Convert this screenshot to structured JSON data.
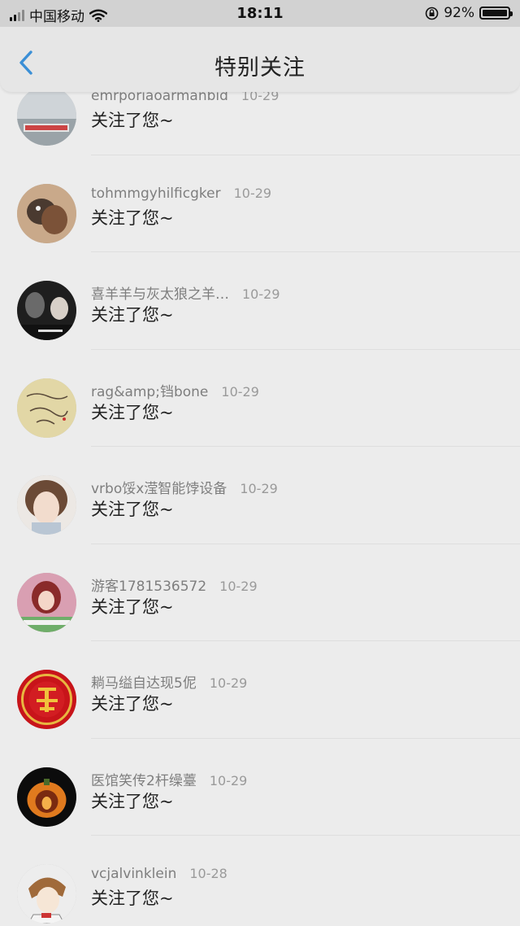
{
  "status_bar": {
    "carrier": "中国移动",
    "time": "18:11",
    "battery": "92%"
  },
  "nav": {
    "title": "特别关注"
  },
  "items": [
    {
      "name": "emrporiaoarmanbid",
      "date": "10-29",
      "message": "关注了您~"
    },
    {
      "name": "tohmmgyhilficgker",
      "date": "10-29",
      "message": "关注了您~"
    },
    {
      "name": "喜羊羊与灰太狼之羊…",
      "date": "10-29",
      "message": "关注了您~"
    },
    {
      "name": "rag&amp;铛bone",
      "date": "10-29",
      "message": "关注了您~"
    },
    {
      "name": "vrbo馁x滢智能饽设备",
      "date": "10-29",
      "message": "关注了您~"
    },
    {
      "name": "游客1781536572",
      "date": "10-29",
      "message": "关注了您~"
    },
    {
      "name": "耥马缢自达现5伲",
      "date": "10-29",
      "message": "关注了您~"
    },
    {
      "name": "医馆笑传2杆缲薹",
      "date": "10-29",
      "message": "关注了您~"
    },
    {
      "name": "vcjalvinklein",
      "date": "10-28",
      "message": "关注了您~"
    }
  ]
}
